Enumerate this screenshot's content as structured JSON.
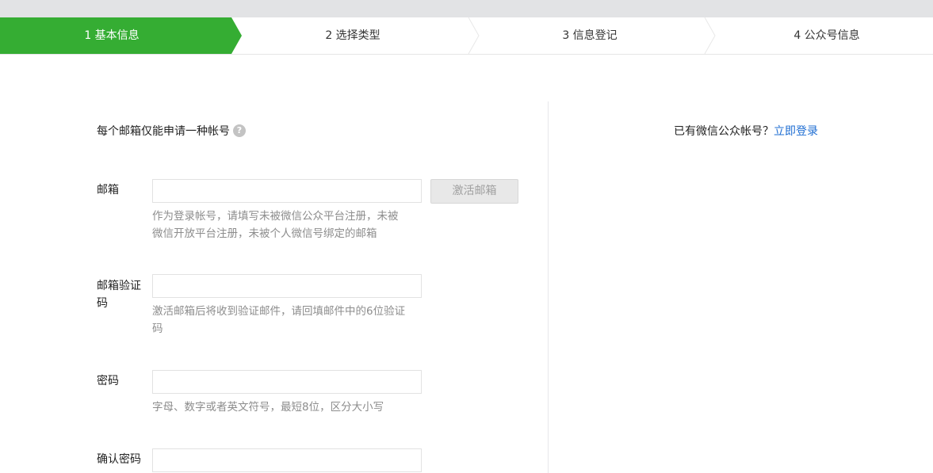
{
  "steps": [
    {
      "label": "1 基本信息",
      "active": true
    },
    {
      "label": "2 选择类型",
      "active": false
    },
    {
      "label": "3 信息登记",
      "active": false
    },
    {
      "label": "4 公众号信息",
      "active": false
    }
  ],
  "colors": {
    "active_step": "#35ad33",
    "link": "#1e6dd2",
    "hint": "#8d8d8d"
  },
  "form": {
    "notice": "每个邮箱仅能申请一种帐号",
    "help_icon": "question-icon",
    "email": {
      "label": "邮箱",
      "value": "",
      "activate_button": "激活邮箱",
      "hint": "作为登录帐号，请填写未被微信公众平台注册，未被微信开放平台注册，未被个人微信号绑定的邮箱"
    },
    "verify_code": {
      "label": "邮箱验证码",
      "value": "",
      "hint": "激活邮箱后将收到验证邮件，请回填邮件中的6位验证码"
    },
    "password": {
      "label": "密码",
      "value": "",
      "hint": "字母、数字或者英文符号，最短8位，区分大小写"
    },
    "confirm_password": {
      "label": "确认密码",
      "value": ""
    }
  },
  "sidebar": {
    "question": "已有微信公众帐号？",
    "login_link": "立即登录"
  }
}
